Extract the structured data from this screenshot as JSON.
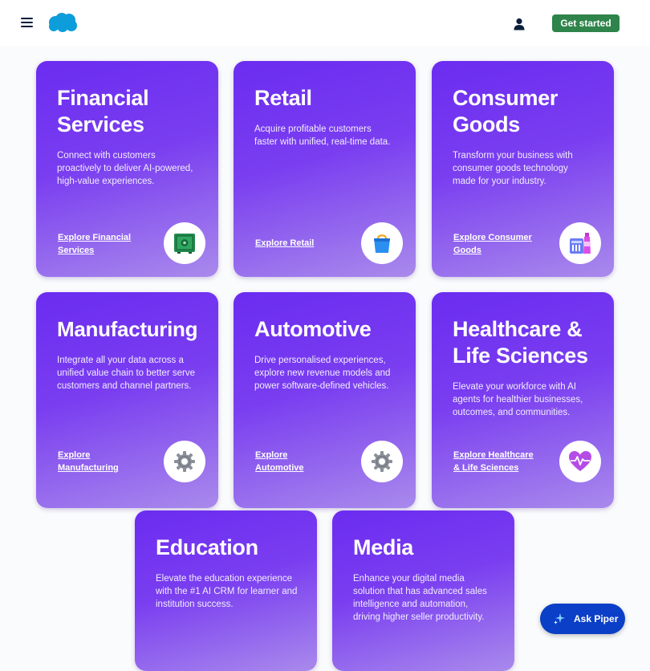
{
  "header": {
    "logo_name": "salesforce-cloud-logo",
    "cta_label": "Get started",
    "colors": {
      "cta": "#2e844a",
      "nav_icon": "#0b1e3a",
      "logo": "#0d9dda"
    }
  },
  "cards": [
    {
      "title": "Financial Services",
      "description": "Connect with customers proactively to deliver AI-powered, high-value experiences.",
      "link": "Explore Financial Services",
      "icon": "safe-icon"
    },
    {
      "title": "Retail",
      "description": "Acquire profitable customers faster with unified, real-time data.",
      "link": "Explore Retail",
      "icon": "shopping-bag-icon"
    },
    {
      "title": "Consumer Goods",
      "description": "Transform your business with consumer goods technology made for your industry.",
      "link": "Explore Consumer Goods",
      "icon": "consumer-goods-icon"
    },
    {
      "title": "Manufacturing",
      "description": "Integrate all your data across a unified value chain to better serve customers and channel partners.",
      "link": "Explore Manufacturing",
      "icon": "gear-icon"
    },
    {
      "title": "Automotive",
      "description": "Drive personalised experiences, explore new revenue models and power software-defined vehicles.",
      "link": "Explore Automotive",
      "icon": "gear-icon"
    },
    {
      "title": "Healthcare & Life Sciences",
      "description": "Elevate your workforce with AI agents for healthier businesses, outcomes, and communities.",
      "link": "Explore Healthcare & Life Sciences",
      "icon": "heart-rate-icon"
    },
    {
      "title": "Education",
      "description": "Elevate the education experience with the #1 AI CRM for learner and institution success."
    },
    {
      "title": "Media",
      "description": "Enhance your digital media solution that has advanced sales intelligence and automation, driving higher seller productivity."
    }
  ],
  "assistant": {
    "label": "Ask Piper",
    "icon": "sparkle-icon",
    "color": "#0b3fc7"
  },
  "theme": {
    "card_gradient_start": "#6b2cf0",
    "card_gradient_end": "#a98aec"
  }
}
